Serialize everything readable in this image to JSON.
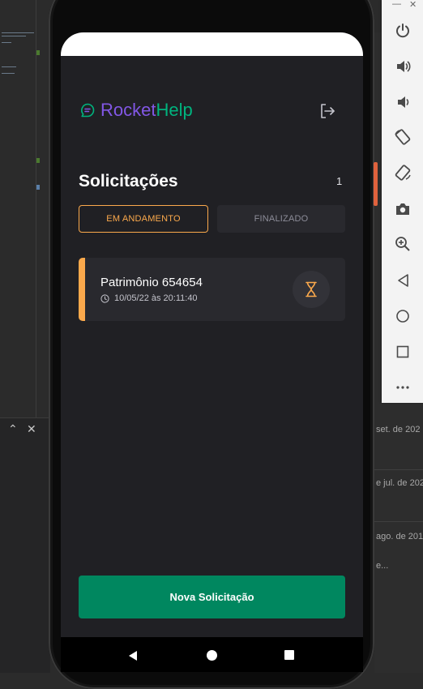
{
  "app": {
    "logo_part1": "Rocket",
    "logo_part2": "Help",
    "brand_purple": "#8257e5",
    "brand_green": "#00b37e"
  },
  "header": {
    "title": "Solicitações",
    "count": "1",
    "logout_icon": "logout-icon"
  },
  "filters": {
    "open_label": "EM ANDAMENTO",
    "closed_label": "FINALIZADO",
    "active": "open",
    "accent": "#fba94c"
  },
  "orders": [
    {
      "patrimony": "Patrimônio 654654",
      "when": "10/05/22 às 20:11:40",
      "status": "open",
      "status_icon": "hourglass-icon",
      "status_color": "#fba94c"
    }
  ],
  "actions": {
    "new_order_label": "Nova Solicitação",
    "button_color": "#00875f"
  },
  "background_window": {
    "rows": [
      "set. de 202",
      "e jul. de 202",
      "ago. de 201",
      "e..."
    ]
  }
}
